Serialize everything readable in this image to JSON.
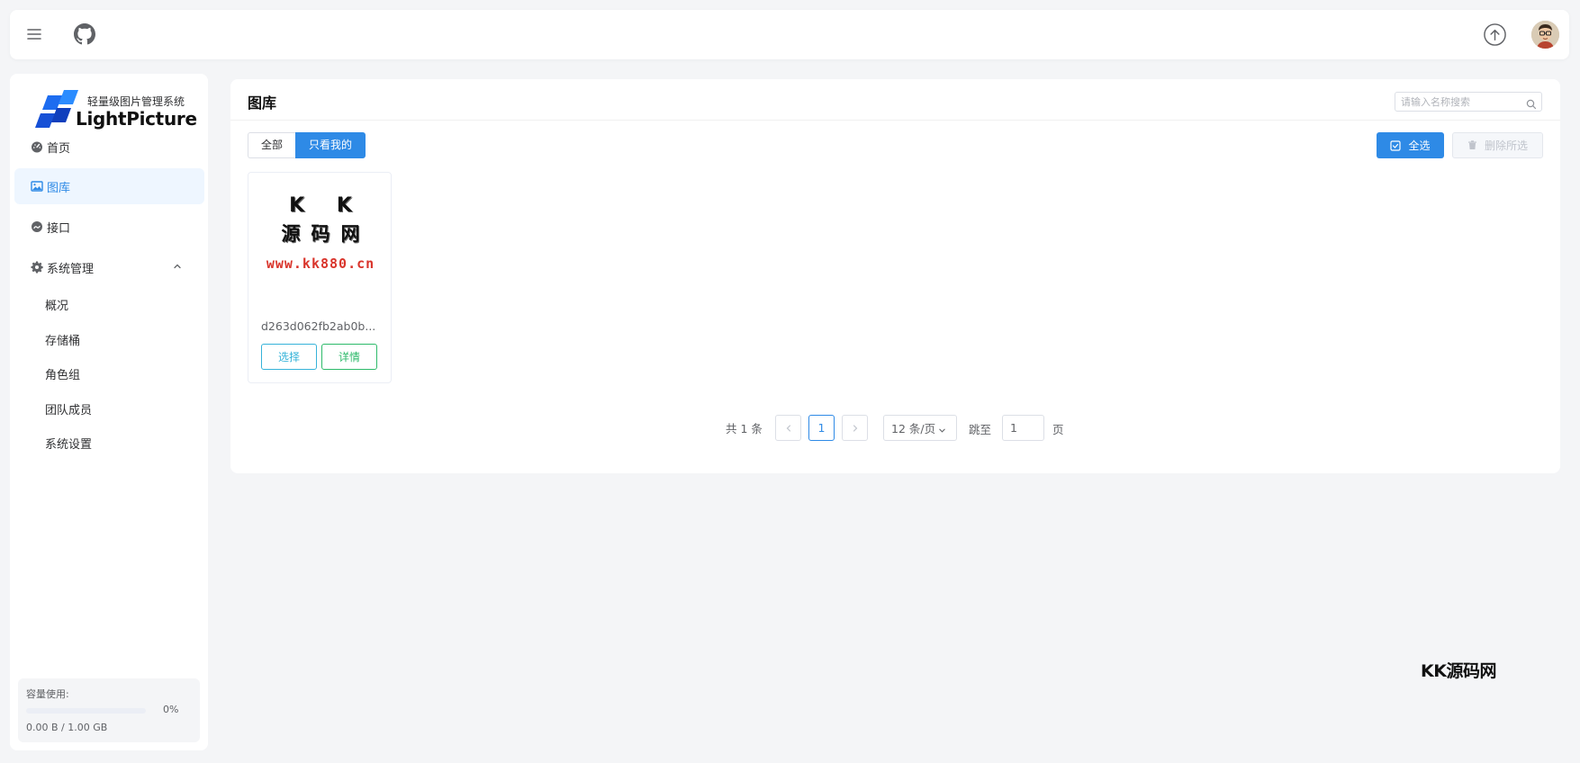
{
  "header": {
    "menu_icon": "hamburger-icon",
    "github_icon": "github-icon",
    "upload_icon": "upload-circle-icon",
    "avatar_icon": "user-avatar"
  },
  "sidebar": {
    "logo": {
      "tagline": "轻量级图片管理系统",
      "brand": "LightPicture"
    },
    "items": [
      {
        "label": "首页",
        "icon": "dashboard-icon",
        "active": false
      },
      {
        "label": "图库",
        "icon": "image-icon",
        "active": true
      },
      {
        "label": "接口",
        "icon": "api-icon",
        "active": false
      },
      {
        "label": "系统管理",
        "icon": "gear-icon",
        "active": false,
        "expanded": true
      }
    ],
    "sub_items": [
      {
        "label": "概况"
      },
      {
        "label": "存储桶"
      },
      {
        "label": "角色组"
      },
      {
        "label": "团队成员"
      },
      {
        "label": "系统设置"
      }
    ],
    "usage": {
      "label": "容量使用:",
      "percent_text": "0%",
      "fraction": 0,
      "size_text": "0.00 B / 1.00 GB"
    }
  },
  "main": {
    "title": "图库",
    "search": {
      "placeholder": "请输入名称搜索",
      "value": ""
    },
    "filter": {
      "all_label": "全部",
      "mine_label": "只看我的",
      "selected": "只看我的"
    },
    "toolbar": {
      "select_all_label": "全选",
      "delete_selected_label": "删除所选"
    },
    "images": [
      {
        "thumb_lines": [
          "K K",
          "源码网",
          "www.kk880.cn"
        ],
        "name": "d263d062fb2ab0b...",
        "select_label": "选择",
        "detail_label": "详情"
      }
    ],
    "pagination": {
      "total_text": "共 1 条",
      "current_page": "1",
      "page_size_text": "12 条/页",
      "jump_label": "跳至",
      "jump_value": "1",
      "page_suffix": "页"
    }
  },
  "watermark": "KK源码网",
  "colors": {
    "primary": "#2e8ae6",
    "select_button": "#36b3d9",
    "detail_button": "#2dba6a",
    "thumb_url": "#d9342b"
  }
}
